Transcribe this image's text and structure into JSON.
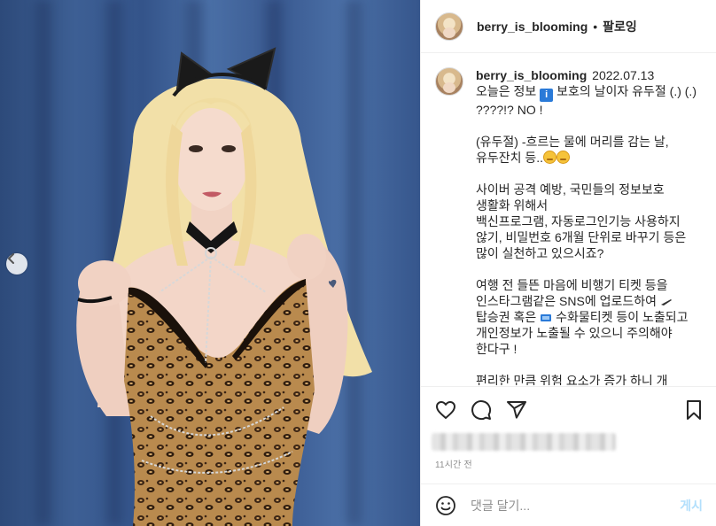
{
  "header": {
    "username": "berry_is_blooming",
    "separator": "•",
    "follow_label": "팔로잉"
  },
  "caption": {
    "username": "berry_is_blooming",
    "date": "2022.07.13",
    "line1_a": "오늘은 정보",
    "info_emoji": "i",
    "line1_b": "보호의 날이자 유두절 (.) (.) ????!? NO !",
    "para2": "(유두절) -흐르는 물에 머리를 감는 날, 유두잔치 등..",
    "para3": "사이버 공격 예방, 국민들의 정보보호 생활화 위해서\n백신프로그램, 자동로그인기능 사용하지 않기, 비밀번호 6개월 단위로 바꾸기 등은 많이 실천하고 있으시죠?",
    "para4_a": "여행 전 들뜬 마음에 비행기 티켓 등을 인스타그램같은 SNS에 업로드하여",
    "para4_b": "탑승권 혹은",
    "para4_c": "수화물티켓 등이 노출되고 개인정보가 노출될 수 있으니 주의해야 한다구 !",
    "para5": "편리한 만큼 위험 요소가 증가 하니 개"
  },
  "actions": {
    "like_icon": "heart-icon",
    "comment_icon": "comment-icon",
    "share_icon": "paper-plane-icon",
    "save_icon": "bookmark-icon"
  },
  "time_ago": "11시간 전",
  "comment": {
    "placeholder": "댓글 달기...",
    "post_label": "게시"
  },
  "colors": {
    "text": "#262626",
    "muted": "#8e8e8e",
    "post_disabled": "#b2dffc",
    "divider": "#efefef"
  }
}
